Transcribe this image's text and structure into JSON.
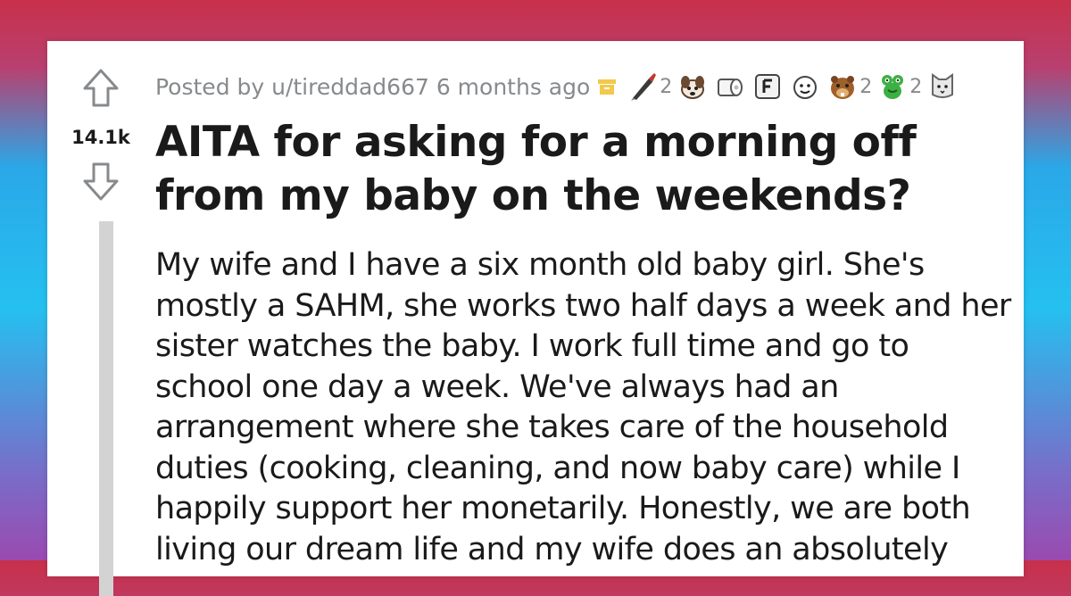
{
  "post": {
    "score": "14.1k",
    "posted_by": "Posted by u/tireddad667 6 months ago",
    "awards": [
      {
        "icon": "pen-award-icon",
        "count": "2"
      },
      {
        "icon": "dog-award-icon",
        "count": ""
      },
      {
        "icon": "toilet-paper-award-icon",
        "count": ""
      },
      {
        "icon": "f-key-award-icon",
        "count": ""
      },
      {
        "icon": "face-award-icon",
        "count": ""
      },
      {
        "icon": "beaver-award-icon",
        "count": "2"
      },
      {
        "icon": "frog-award-icon",
        "count": "2"
      },
      {
        "icon": "cat-award-icon",
        "count": ""
      }
    ],
    "title": "AITA for asking for a morning off from my baby on the weekends?",
    "body": "My wife and I have a six month old baby girl. She's mostly a SAHM, she works two half days a week and her sister watches the baby. I work full time and go to school one day a week. We've always had an arrangement where she takes care of the household duties (cooking, cleaning, and now baby care) while I happily support her monetarily. Honestly, we are both living our dream life and my wife does an absolutely"
  },
  "colors": {
    "text": "#1a1a1b",
    "meta": "#878a8c",
    "pin": "#f2c94c",
    "thread": "#d3d3d3"
  }
}
